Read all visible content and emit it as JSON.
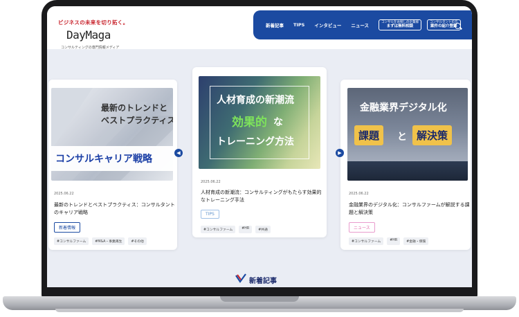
{
  "header": {
    "tagline": "ビジネスの未来を切り拓く。",
    "logo": "DayMaga",
    "subtitle": "コンサルティングの専門情報メディア",
    "nav": [
      "新着記事",
      "TIPS",
      "インタビュー",
      "ニュース"
    ],
    "cta1_small": "コンサルをお探しの企業様",
    "cta1_big": "まずは無料相談",
    "cta2_small": "コンサルタントの方",
    "cta2_big": "案件の紹介登録"
  },
  "cards": [
    {
      "thumb_lines": [
        "最新のトレンドと",
        "ベストプラクティス"
      ],
      "thumb_banner": "コンサルキャリア戦略",
      "date": "2025.06.22",
      "title_lines": [
        "最新のトレンドとベストプラクティス：コンサルタント",
        "のキャリア戦略"
      ],
      "category": "新着情報",
      "tags": [
        "#コンサルファーム",
        "#M&A・事業再生",
        "#その他"
      ]
    },
    {
      "thumb_lines": [
        "人材育成の新潮流",
        "効果的",
        "な",
        "トレーニング方法"
      ],
      "date": "2025.06.22",
      "title_lines": [
        "人材育成の新潮流：コンサルティングがもたらす効果的",
        "なトレーニング手法"
      ],
      "category": "TIPS",
      "tags": [
        "#コンサルファーム",
        "#HR",
        "#共通"
      ]
    },
    {
      "thumb_lines": [
        "金融業界デジタル化",
        "課題",
        "と",
        "解決策"
      ],
      "date": "2025.06.22",
      "title_lines": [
        "金融業界のデジタル化：コンサルファームが解説する課",
        "題と解決策"
      ],
      "category": "ニュース",
      "tags": [
        "#コンサルファーム",
        "#HR",
        "#金融・保険"
      ]
    }
  ],
  "section_title": "新着記事",
  "colors": {
    "brand": "#1b4aa1",
    "news_pink": "#e066a8",
    "tips_blue": "#5b8fc9"
  }
}
